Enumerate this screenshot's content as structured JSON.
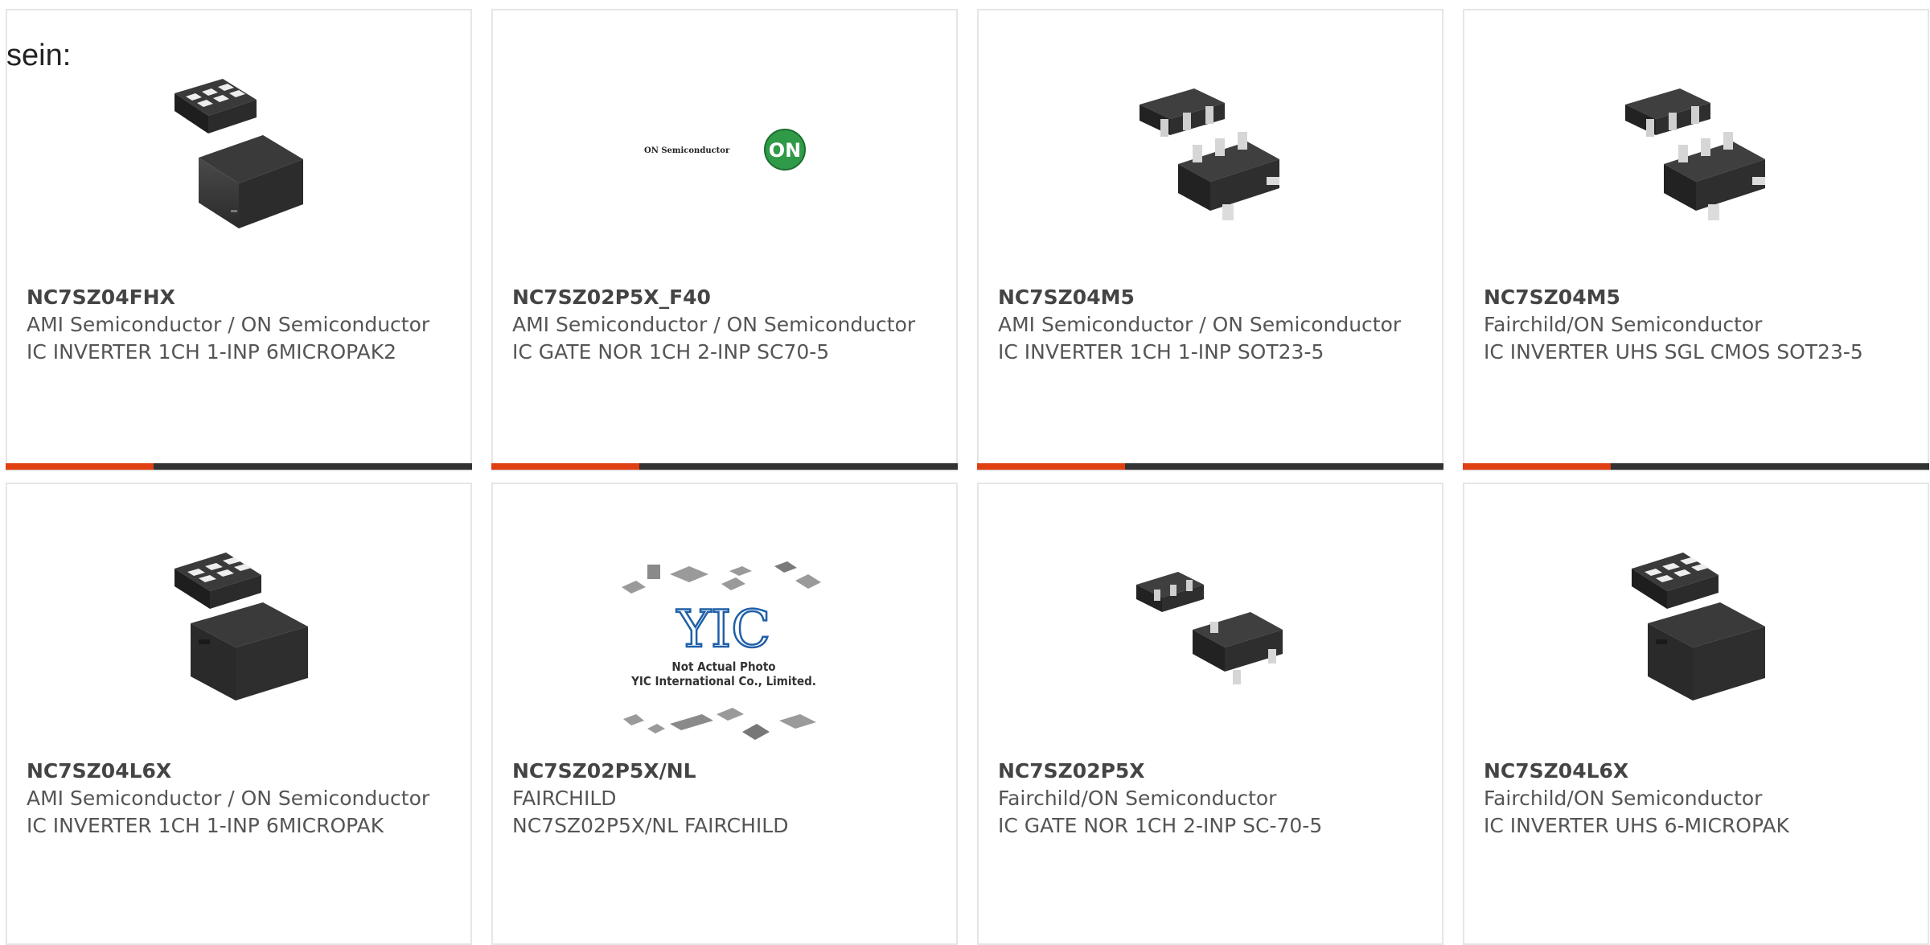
{
  "intro_text": "sein:",
  "colors": {
    "accent": "#e03f11",
    "bar": "#333333",
    "border": "#e6e6e6",
    "on_logo": "#2f9a47"
  },
  "products": [
    {
      "part": "NC7SZ04FHX",
      "manufacturer": "AMI Semiconductor / ON Semiconductor",
      "description": "IC INVERTER 1CH 1-INP 6MICROPAK2",
      "image": "micropak-package-icon"
    },
    {
      "part": "NC7SZ02P5X_F40",
      "manufacturer": "AMI Semiconductor / ON Semiconductor",
      "description": "IC GATE NOR 1CH 2-INP SC70-5",
      "image": "on-semiconductor-logo",
      "logo_text": "ON Semiconductor",
      "logo_badge": "ON"
    },
    {
      "part": "NC7SZ04M5",
      "manufacturer": "AMI Semiconductor / ON Semiconductor",
      "description": "IC INVERTER 1CH 1-INP SOT23-5",
      "image": "sot23-package-icon"
    },
    {
      "part": "NC7SZ04M5",
      "manufacturer": "Fairchild/ON Semiconductor",
      "description": "IC INVERTER UHS SGL CMOS SOT23-5",
      "image": "sot23-package-icon"
    },
    {
      "part": "NC7SZ04L6X",
      "manufacturer": "AMI Semiconductor / ON Semiconductor",
      "description": "IC INVERTER 1CH 1-INP 6MICROPAK",
      "image": "micropak-package-icon"
    },
    {
      "part": "NC7SZ02P5X/NL",
      "manufacturer": "FAIRCHILD",
      "description": "NC7SZ02P5X/NL FAIRCHILD",
      "image": "yic-placeholder-image",
      "placeholder_logo": "YIC",
      "placeholder_line1": "Not Actual Photo",
      "placeholder_line2": "YIC International Co., Limited."
    },
    {
      "part": "NC7SZ02P5X",
      "manufacturer": "Fairchild/ON Semiconductor",
      "description": "IC GATE NOR 1CH 2-INP SC-70-5",
      "image": "sc70-package-icon"
    },
    {
      "part": "NC7SZ04L6X",
      "manufacturer": "Fairchild/ON Semiconductor",
      "description": "IC INVERTER UHS 6-MICROPAK",
      "image": "micropak-package-icon"
    }
  ]
}
